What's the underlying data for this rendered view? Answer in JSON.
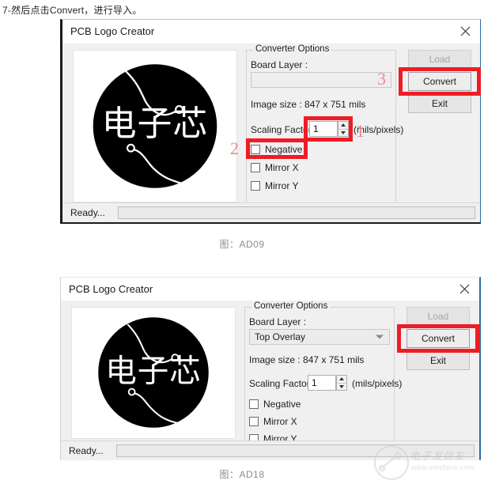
{
  "instruction": "7-然后点击Convert，进行导入。",
  "dialogs": [
    {
      "title": "PCB Logo Creator",
      "close_icon": "close-icon",
      "group": {
        "legend": "Converter Options",
        "board_layer_label": "Board Layer :",
        "board_layer_value": "",
        "image_size": "Image size : 847 x 751 mils",
        "scaling_label": "Scaling Factor :",
        "scaling_value": "1",
        "scaling_units": "(mils/pixels)",
        "checkboxes": [
          {
            "label": "Negative",
            "checked": false
          },
          {
            "label": "Mirror X",
            "checked": false
          },
          {
            "label": "Mirror Y",
            "checked": false
          }
        ]
      },
      "buttons": [
        {
          "label": "Load",
          "enabled": false
        },
        {
          "label": "Convert",
          "enabled": true
        },
        {
          "label": "Exit",
          "enabled": true
        }
      ],
      "status": "Ready...",
      "annotations": [
        {
          "number": "1"
        },
        {
          "number": "2"
        },
        {
          "number": "3"
        }
      ],
      "caption": "图：AD09"
    },
    {
      "title": "PCB Logo Creator",
      "close_icon": "close-icon",
      "group": {
        "legend": "Converter Options",
        "board_layer_label": "Board Layer :",
        "board_layer_value": "Top Overlay",
        "image_size": "Image size : 847 x 751 mils",
        "scaling_label": "Scaling Factor :",
        "scaling_value": "1",
        "scaling_units": "(mils/pixels)",
        "checkboxes": [
          {
            "label": "Negative",
            "checked": false
          },
          {
            "label": "Mirror X",
            "checked": false
          },
          {
            "label": "Mirror Y",
            "checked": false
          }
        ]
      },
      "buttons": [
        {
          "label": "Load",
          "enabled": false
        },
        {
          "label": "Convert",
          "enabled": true
        },
        {
          "label": "Exit",
          "enabled": true
        }
      ],
      "status": "Ready...",
      "annotations": [],
      "caption": "图：AD18"
    }
  ],
  "logo": {
    "text": "电子芯",
    "background": "#000000",
    "foreground": "#ffffff"
  },
  "watermark": {
    "text": "电子发烧友",
    "url": "www.elecfans.com"
  },
  "colors": {
    "annotation_red": "#ee1c25",
    "annotation_number": "#e58b91",
    "dialog_bg": "#f0f0f0",
    "titlebar_bg": "#ffffff"
  }
}
